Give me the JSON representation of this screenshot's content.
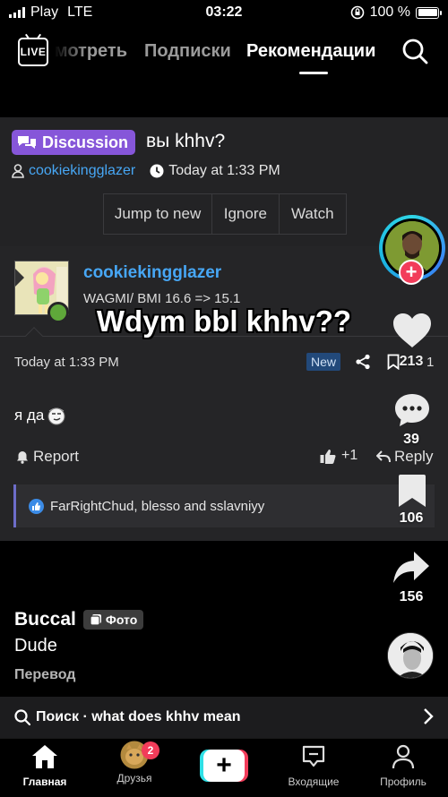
{
  "status_bar": {
    "carrier": "Play",
    "network": "LTE",
    "time": "03:22",
    "battery": "100 %",
    "icons": [
      "signal-icon",
      "orientation-lock-icon",
      "battery-icon"
    ]
  },
  "top_nav": {
    "live_label": "LIVE",
    "tabs": [
      {
        "label": "мотреть",
        "active": false
      },
      {
        "label": "Подписки",
        "active": false
      },
      {
        "label": "Рекомендации",
        "active": true
      }
    ]
  },
  "thread": {
    "badge": "Discussion",
    "title": "вы khhv?",
    "author": "cookiekingglazer",
    "time": "Today at 1:33 PM",
    "actions": [
      "Jump to new",
      "Ignore",
      "Watch"
    ]
  },
  "post": {
    "username": "cookiekingglazer",
    "user_title": "WAGMI/ BMI 16.6 => 15.1",
    "date": "Today at 1:33 PM",
    "new_label": "New",
    "body": "я да",
    "report_label": "Report",
    "like_label": "+1",
    "reply_label": "Reply",
    "liked_by": "FarRightChud, blesso and sslavniyy",
    "edge_fragment": "1"
  },
  "caption": "Wdym bbl khhv??",
  "rail": {
    "likes": "213",
    "comments": "39",
    "saves": "106",
    "shares": "156"
  },
  "video_info": {
    "author": "Buccal",
    "tag": "Фото",
    "description": "Dude",
    "translate": "Перевод"
  },
  "search_suggestion": "Поиск · what does khhv mean",
  "tab_bar": {
    "items": [
      {
        "label": "Главная",
        "active": true
      },
      {
        "label": "Друзья",
        "active": false
      },
      {
        "label": "Входящие",
        "active": false
      },
      {
        "label": "Профиль",
        "active": false
      }
    ],
    "friends_badge": "2"
  },
  "colors": {
    "accent_blue": "#47a7f5",
    "discussion_purple": "#8656d9",
    "tiktok_red": "#f23c5a",
    "tiktok_cyan": "#2fe0e6"
  }
}
